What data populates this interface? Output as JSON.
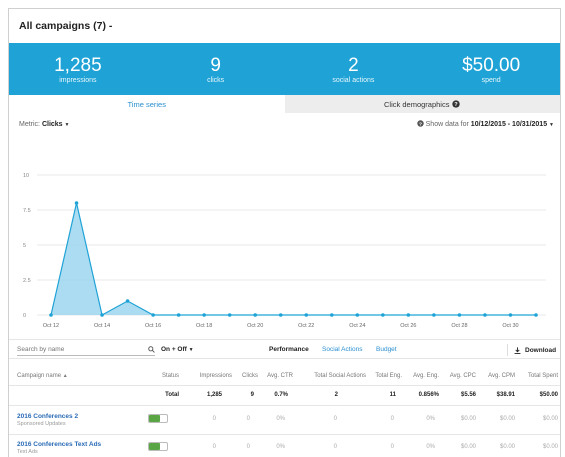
{
  "header": {
    "title": "All campaigns (7) -"
  },
  "stats": [
    {
      "value": "1,285",
      "label": "impressions"
    },
    {
      "value": "9",
      "label": "clicks"
    },
    {
      "value": "2",
      "label": "social actions"
    },
    {
      "value": "$50.00",
      "label": "spend"
    }
  ],
  "tabs": {
    "time_series": "Time series",
    "click_demographics": "Click demographics"
  },
  "metric": {
    "label": "Metric:",
    "value": "Clicks",
    "show_data_label": "Show data for",
    "date_range": "10/12/2015 - 10/31/2015"
  },
  "chart_data": {
    "type": "area",
    "x": [
      "Oct 12",
      "Oct 13",
      "Oct 14",
      "Oct 15",
      "Oct 16",
      "Oct 17",
      "Oct 18",
      "Oct 19",
      "Oct 20",
      "Oct 21",
      "Oct 22",
      "Oct 23",
      "Oct 24",
      "Oct 25",
      "Oct 26",
      "Oct 27",
      "Oct 28",
      "Oct 29",
      "Oct 30",
      "Oct 31"
    ],
    "values": [
      0,
      8,
      0,
      1,
      0,
      0,
      0,
      0,
      0,
      0,
      0,
      0,
      0,
      0,
      0,
      0,
      0,
      0,
      0,
      0
    ],
    "x_tick_labels": [
      "Oct 12",
      "Oct 14",
      "Oct 16",
      "Oct 18",
      "Oct 20",
      "Oct 22",
      "Oct 24",
      "Oct 26",
      "Oct 28",
      "Oct 30"
    ],
    "y_ticks": [
      "0",
      "2.5",
      "5",
      "7.5",
      "10"
    ],
    "ylim": [
      0,
      10
    ],
    "grid": true,
    "color": "#1fa3d6",
    "fill": "#9dd6ef"
  },
  "toolbar": {
    "search_placeholder": "Search by name",
    "filter_label": "On + Off",
    "performance": "Performance",
    "social_actions": "Social Actions",
    "budget": "Budget",
    "download": "Download"
  },
  "table": {
    "columns": [
      "Campaign name",
      "Status",
      "Impressions",
      "Clicks",
      "Avg. CTR",
      "Total Social Actions",
      "Total Eng.",
      "Avg. Eng.",
      "Avg. CPC",
      "Avg. CPM",
      "Total Spent"
    ],
    "total": {
      "label": "Total",
      "values": [
        "1,285",
        "9",
        "0.7%",
        "2",
        "11",
        "0.856%",
        "$5.56",
        "$38.91",
        "$50.00"
      ]
    },
    "rows": [
      {
        "name": "2016 Conferences 2",
        "sub": "Sponsored Updates",
        "status_on": true,
        "values": [
          "0",
          "0",
          "0%",
          "0",
          "0",
          "0%",
          "$0.00",
          "$0.00",
          "$0.00"
        ]
      },
      {
        "name": "2016 Conferences Text Ads",
        "sub": "Text Ads",
        "status_on": true,
        "values": [
          "0",
          "0",
          "0%",
          "0",
          "0",
          "0%",
          "$0.00",
          "$0.00",
          "$0.00"
        ]
      }
    ]
  }
}
